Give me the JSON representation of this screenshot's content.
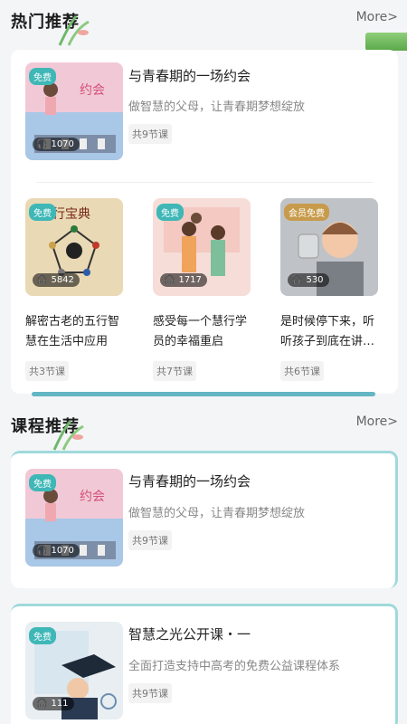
{
  "hot": {
    "title": "热门推荐",
    "more": "More>",
    "featured": {
      "title": "与青春期的一场约会",
      "subtitle": "做智慧的父母，让青春期梦想绽放",
      "lessons": "共9节课",
      "badge": "免费",
      "count": "1070"
    },
    "grid": [
      {
        "title": "解密古老的五行智慧在生活中应用",
        "lessons": "共3节课",
        "badge": "免费",
        "count": "5842",
        "art_text": "五行宝典"
      },
      {
        "title": "感受每一个慧行学员的幸福重启",
        "lessons": "共7节课",
        "badge": "免费",
        "count": "1717"
      },
      {
        "title": "是时候停下来，听听孩子到底在讲…",
        "lessons": "共6节课",
        "badge": "会员免费",
        "count": "530"
      }
    ]
  },
  "course": {
    "title": "课程推荐",
    "more": "More>",
    "items": [
      {
        "title": "与青春期的一场约会",
        "subtitle": "做智慧的父母，让青春期梦想绽放",
        "lessons": "共9节课",
        "badge": "免费",
        "count": "1070"
      },
      {
        "title": "智慧之光公开课・一",
        "subtitle": "全面打造支持中高考的免费公益课程体系",
        "lessons": "共9节课",
        "badge": "免费",
        "count": "111"
      }
    ]
  },
  "colors": {
    "teal": "#3fb7b7",
    "vip": "#c79b4b",
    "teal_bar": "#63b6c4"
  }
}
